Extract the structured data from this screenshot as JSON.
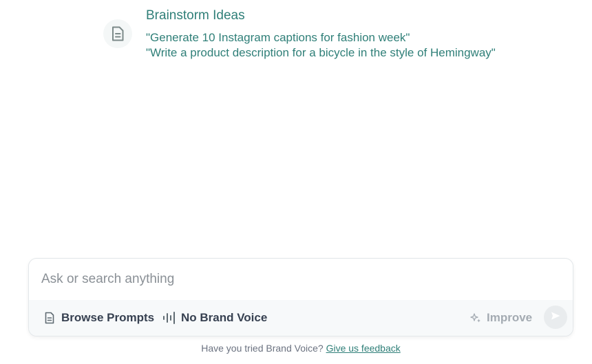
{
  "example": {
    "icon": "document-icon",
    "title": "Brainstorm Ideas",
    "lines": [
      "\"Generate 10 Instagram captions for fashion week\"",
      "\"Write a product description for a bicycle in the style of Hemingway\""
    ]
  },
  "composer": {
    "placeholder": "Ask or search anything",
    "browse_prompts_label": "Browse Prompts",
    "browse_prompts_icon": "document-icon",
    "brand_voice_label": "No Brand Voice",
    "brand_voice_icon": "sound-wave-icon",
    "improve_label": "Improve",
    "improve_icon": "sparkle-icon",
    "send_icon": "send-icon"
  },
  "footer": {
    "prompt_text": "Have you tried Brand Voice?",
    "link_text": "Give us feedback"
  },
  "colors": {
    "accent": "#2f7f78",
    "text": "#374151",
    "muted": "#8a9096",
    "disabled": "#a4abb2",
    "toolbar_bg": "#f7f9fa"
  }
}
